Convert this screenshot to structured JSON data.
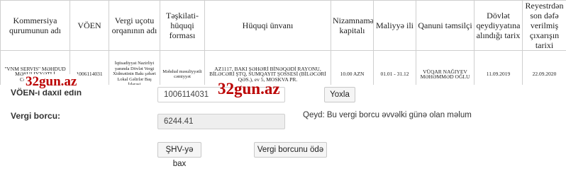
{
  "table": {
    "headers": [
      "Kommersiya qurumunun adı",
      "VÖEN",
      "Vergi uçotu orqanının adı",
      "Təşkilati-hüquqi forması",
      "Hüquqi ünvanı",
      "Nizamnamə kapitalı",
      "Maliyyə ili",
      "Qanuni təmsilçi",
      "Dövlət qeydiyyatına alındığı tarix",
      "Reyestrdən son dəfə verilmiş çıxarışın tarixi"
    ],
    "row": {
      "name": "\"VNM SERVIS\" MƏHDUD MƏSULIYYƏTLİ CƏMİYYƏTİ",
      "voen": "1006114031",
      "tax_office": "İqtisadiyyat Nazirliyi yanında Dövlət Vergi Xidmətinin Bakı şəhəri Lokal Gəlirlər Baş İdarəsi",
      "legal_form": "Məhdud məsuliyyətli cəmiyyət",
      "address": "AZ1117, BAKI ŞƏHƏRİ BİNƏQƏDİ RAYONU, BİLƏCƏRİ ŞTQ, SUMQAYIT ŞOSSESİ (BİLƏCƏRİ QƏS.), ev 5, MOSKVA PR.",
      "capital": "10.00 AZN",
      "fiscal_year": "01.01 - 31.12",
      "representative": "VÜQAR NAĞIYEV MƏHƏMMƏD OĞLU",
      "registration_date": "11.09.2019",
      "extract_date": "22.09.2020"
    }
  },
  "watermark": "32gun.az",
  "form": {
    "voen_label": "VÖEN-i daxil edin",
    "voen_value": "1006114031",
    "check_button": "Yoxla",
    "debt_label": "Vergi borcu:",
    "debt_value": "6244.41",
    "note": "Qeyd: Bu vergi borcu əvvəlki günə olan məlum",
    "shv_button": "ŞHV-yə bax",
    "pay_button": "Vergi borcunu ödə"
  }
}
